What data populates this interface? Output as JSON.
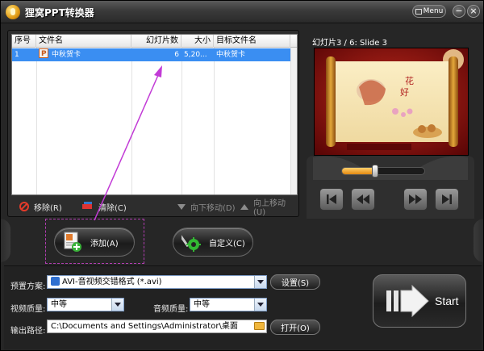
{
  "window": {
    "title": "狸窝PPT转换器",
    "menu_label": "Menu",
    "minimize_glyph": "−",
    "close_glyph": "×"
  },
  "file_table": {
    "columns": [
      "序号",
      "文件名",
      "幻灯片数",
      "大小",
      "目标文件名"
    ],
    "rows": [
      {
        "index": "1",
        "filename": "中秋贺卡",
        "slides": "6",
        "size": "5,20...",
        "target": "中秋贺卡"
      }
    ]
  },
  "list_actions": {
    "remove": "移除(R)",
    "clear": "清除(C)",
    "move_down": "向下移动(D)",
    "move_up": "向上移动(U)"
  },
  "preview": {
    "label": "幻灯片3 / 6: Slide 3",
    "progress": 0.4
  },
  "buttons": {
    "add": "添加(A)",
    "customize": "自定义(C)",
    "settings": "设置(S)",
    "open": "打开(O)",
    "start": "Start"
  },
  "settings": {
    "preset_label": "预置方案:",
    "preset_value": "AVI-音视频交错格式 (*.avi)",
    "video_quality_label": "视频质量:",
    "video_quality_value": "中等",
    "audio_quality_label": "音频质量:",
    "audio_quality_value": "中等",
    "output_path_label": "输出路径:",
    "output_path_value": "C:\\Documents and Settings\\Administrator\\桌面"
  },
  "colors": {
    "selection": "#3a8ef2",
    "accent_orange": "#e48a10",
    "annotation_magenta": "#c23bd6"
  },
  "icons": [
    "app-logo-icon",
    "ppt-file-icon",
    "remove-icon",
    "clear-icon",
    "move-down-icon",
    "move-up-icon",
    "add-file-icon",
    "gear-icon",
    "folder-icon",
    "avi-format-icon",
    "start-arrow-icon"
  ]
}
